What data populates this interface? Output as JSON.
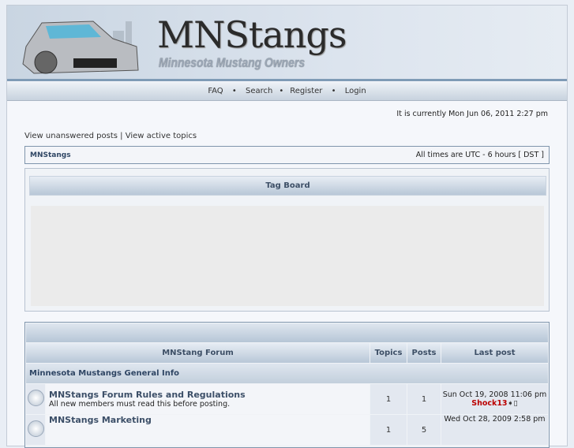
{
  "header": {
    "logo": "MNStangs",
    "tagline": "Minnesota Mustang Owners"
  },
  "nav": {
    "faq": "FAQ",
    "search": "Search",
    "register": "Register",
    "login": "Login",
    "sep": "•"
  },
  "current_time": "It is currently Mon Jun 06, 2011 2:27 pm",
  "links": {
    "unanswered": "View unanswered posts",
    "sep": "|",
    "active": "View active topics"
  },
  "breadcrumb": {
    "home": "MNStangs",
    "timezone": "All times are UTC - 6 hours [ DST ]"
  },
  "tagboard": {
    "title": "Tag Board"
  },
  "forum_table": {
    "headers": {
      "forum": "MNStang Forum",
      "topics": "Topics",
      "posts": "Posts",
      "last_post": "Last post"
    },
    "category": "Minnesota Mustangs General Info",
    "rows": [
      {
        "title": "MNStangs Forum Rules and Regulations",
        "desc": "All new members must read this before posting.",
        "topics": "1",
        "posts": "1",
        "last_date": "Sun Oct 19, 2008 11:06 pm",
        "last_user": "Shock13"
      },
      {
        "title": "MNStangs Marketing",
        "desc": "",
        "topics": "1",
        "posts": "5",
        "last_date": "Wed Oct 28, 2009 2:58 pm",
        "last_user": ""
      }
    ]
  }
}
